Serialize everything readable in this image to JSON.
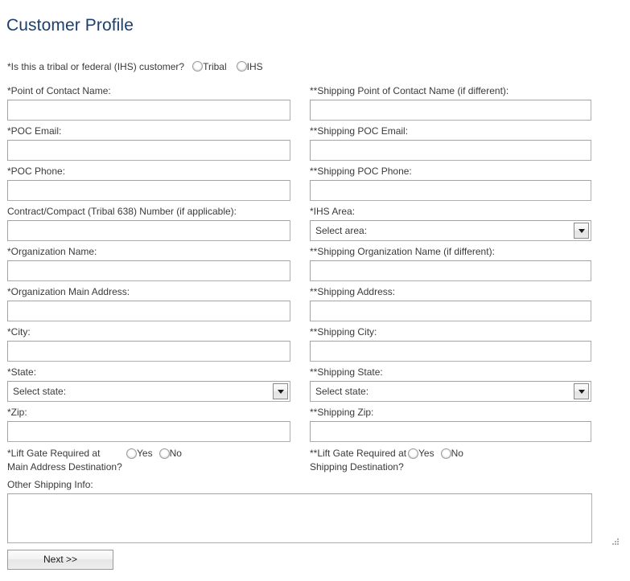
{
  "page": {
    "title": "Customer Profile",
    "title_color": "#1c3f6e"
  },
  "tribal_question": {
    "label": "*Is this a tribal or federal (IHS) customer?",
    "options": [
      {
        "label": "Tribal",
        "selected": false
      },
      {
        "label": "IHS",
        "selected": false
      }
    ]
  },
  "fields": {
    "poc_name": {
      "label": "*Point of Contact Name:",
      "value": "",
      "placeholder": ""
    },
    "shipping_poc_name": {
      "label": "**Shipping Point of Contact Name (if different):",
      "value": "",
      "placeholder": ""
    },
    "poc_email": {
      "label": "*POC Email:",
      "value": "",
      "placeholder": ""
    },
    "shipping_poc_email": {
      "label": "**Shipping POC Email:",
      "value": "",
      "placeholder": ""
    },
    "poc_phone": {
      "label": "*POC Phone:",
      "value": "",
      "placeholder": ""
    },
    "shipping_poc_phone": {
      "label": "**Shipping POC Phone:",
      "value": "",
      "placeholder": ""
    },
    "contract_number": {
      "label": "Contract/Compact (Tribal 638) Number (if applicable):",
      "value": "",
      "placeholder": ""
    },
    "ihs_area": {
      "label": "*IHS Area:",
      "selected": "Select area:"
    },
    "org_name": {
      "label": "*Organization Name:",
      "value": "",
      "placeholder": ""
    },
    "shipping_org_name": {
      "label": "**Shipping Organization Name (if different):",
      "value": "",
      "placeholder": ""
    },
    "org_address": {
      "label": "*Organization Main Address:",
      "value": "",
      "placeholder": ""
    },
    "shipping_address": {
      "label": "**Shipping Address:",
      "value": "",
      "placeholder": ""
    },
    "city": {
      "label": "*City:",
      "value": "",
      "placeholder": ""
    },
    "shipping_city": {
      "label": "**Shipping City:",
      "value": "",
      "placeholder": ""
    },
    "state": {
      "label": "*State:",
      "selected": "Select state:"
    },
    "shipping_state": {
      "label": "**Shipping State:",
      "selected": "Select state:"
    },
    "zip": {
      "label": "*Zip:",
      "value": "",
      "placeholder": ""
    },
    "shipping_zip": {
      "label": "**Shipping Zip:",
      "value": "",
      "placeholder": ""
    }
  },
  "liftgate_main": {
    "label_line1": "*Lift Gate Required at",
    "label_line2": " Main Address Destination?",
    "options": [
      {
        "label": "Yes",
        "selected": false
      },
      {
        "label": "No",
        "selected": false
      }
    ]
  },
  "liftgate_shipping": {
    "label_line1": "**Lift Gate Required at",
    "label_line2": "Shipping Destination?",
    "options": [
      {
        "label": "Yes",
        "selected": false
      },
      {
        "label": "No",
        "selected": false
      }
    ]
  },
  "other_shipping": {
    "label": "Other Shipping Info:",
    "value": "",
    "placeholder": ""
  },
  "next_button": {
    "label": "Next >>"
  }
}
